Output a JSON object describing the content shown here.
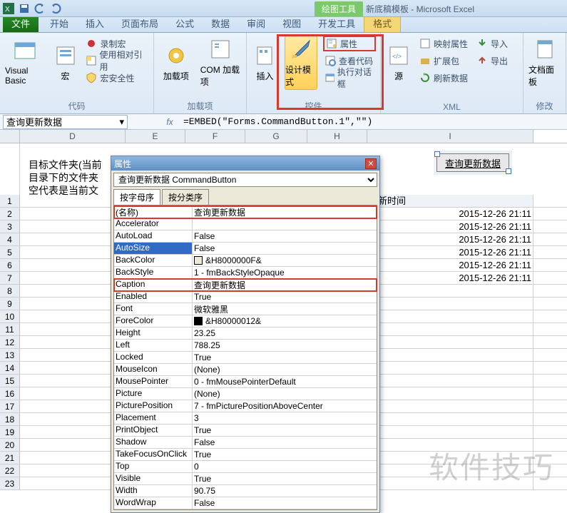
{
  "title": {
    "context_tab": "绘图工具",
    "doc": "新底稿模板 - Microsoft Excel"
  },
  "tabs": {
    "file": "文件",
    "home": "开始",
    "insert": "插入",
    "layout": "页面布局",
    "formulas": "公式",
    "data": "数据",
    "review": "审阅",
    "view": "视图",
    "developer": "开发工具",
    "format": "格式"
  },
  "ribbon": {
    "code": {
      "vb": "Visual Basic",
      "macros": "宏",
      "record": "录制宏",
      "relref": "使用相对引用",
      "security": "宏安全性",
      "label": "代码"
    },
    "addins": {
      "addins": "加载项",
      "com": "COM 加载项",
      "label": "加载项"
    },
    "controls": {
      "insert": "插入",
      "design": "设计模式",
      "props": "属性",
      "viewcode": "查看代码",
      "rundlg": "执行对话框",
      "label": "控件"
    },
    "xml": {
      "source": "源",
      "mapprops": "映射属性",
      "expand": "扩展包",
      "refresh": "刷新数据",
      "import": "导入",
      "export": "导出",
      "label": "XML"
    },
    "modify": {
      "panel": "文档面板",
      "label": "修改"
    }
  },
  "namebox": "查询更新数据",
  "formula": "=EMBED(\"Forms.CommandButton.1\",\"\")",
  "cols": {
    "D": 148,
    "E": 84,
    "F": 84,
    "G": 87,
    "H": 84,
    "I": 233
  },
  "paragraph": {
    "l1": "目标文件夹(当前",
    "l2": "目录下的文件夹",
    "l3": "空代表是当前文"
  },
  "cmdbtn_caption": "查询更新数据",
  "table_header": "更新时间",
  "table_rows": [
    "2015-12-26 21:11",
    "2015-12-26 21:11",
    "2015-12-26 21:11",
    "2015-12-26 21:11",
    "2015-12-26 21:11",
    "2015-12-26 21:11"
  ],
  "prop": {
    "title": "属性",
    "object": "查询更新数据 CommandButton",
    "tab_alpha": "按字母序",
    "tab_cat": "按分类序",
    "rows": [
      {
        "k": "(名称)",
        "v": "查询更新数据",
        "red": true
      },
      {
        "k": "Accelerator",
        "v": ""
      },
      {
        "k": "AutoLoad",
        "v": "False"
      },
      {
        "k": "AutoSize",
        "v": "False",
        "sel": true
      },
      {
        "k": "BackColor",
        "v": "&H8000000F&",
        "swatch": "#ece9d8"
      },
      {
        "k": "BackStyle",
        "v": "1 - fmBackStyleOpaque"
      },
      {
        "k": "Caption",
        "v": "查询更新数据",
        "red": true
      },
      {
        "k": "Enabled",
        "v": "True"
      },
      {
        "k": "Font",
        "v": "微软雅黑"
      },
      {
        "k": "ForeColor",
        "v": "&H80000012&",
        "swatch": "#000000"
      },
      {
        "k": "Height",
        "v": "23.25"
      },
      {
        "k": "Left",
        "v": "788.25"
      },
      {
        "k": "Locked",
        "v": "True"
      },
      {
        "k": "MouseIcon",
        "v": "(None)"
      },
      {
        "k": "MousePointer",
        "v": "0 - fmMousePointerDefault"
      },
      {
        "k": "Picture",
        "v": "(None)"
      },
      {
        "k": "PicturePosition",
        "v": "7 - fmPicturePositionAboveCenter"
      },
      {
        "k": "Placement",
        "v": "3"
      },
      {
        "k": "PrintObject",
        "v": "True"
      },
      {
        "k": "Shadow",
        "v": "False"
      },
      {
        "k": "TakeFocusOnClick",
        "v": "True"
      },
      {
        "k": "Top",
        "v": "0"
      },
      {
        "k": "Visible",
        "v": "True"
      },
      {
        "k": "Width",
        "v": "90.75"
      },
      {
        "k": "WordWrap",
        "v": "False"
      }
    ]
  },
  "watermark": "软件技巧"
}
